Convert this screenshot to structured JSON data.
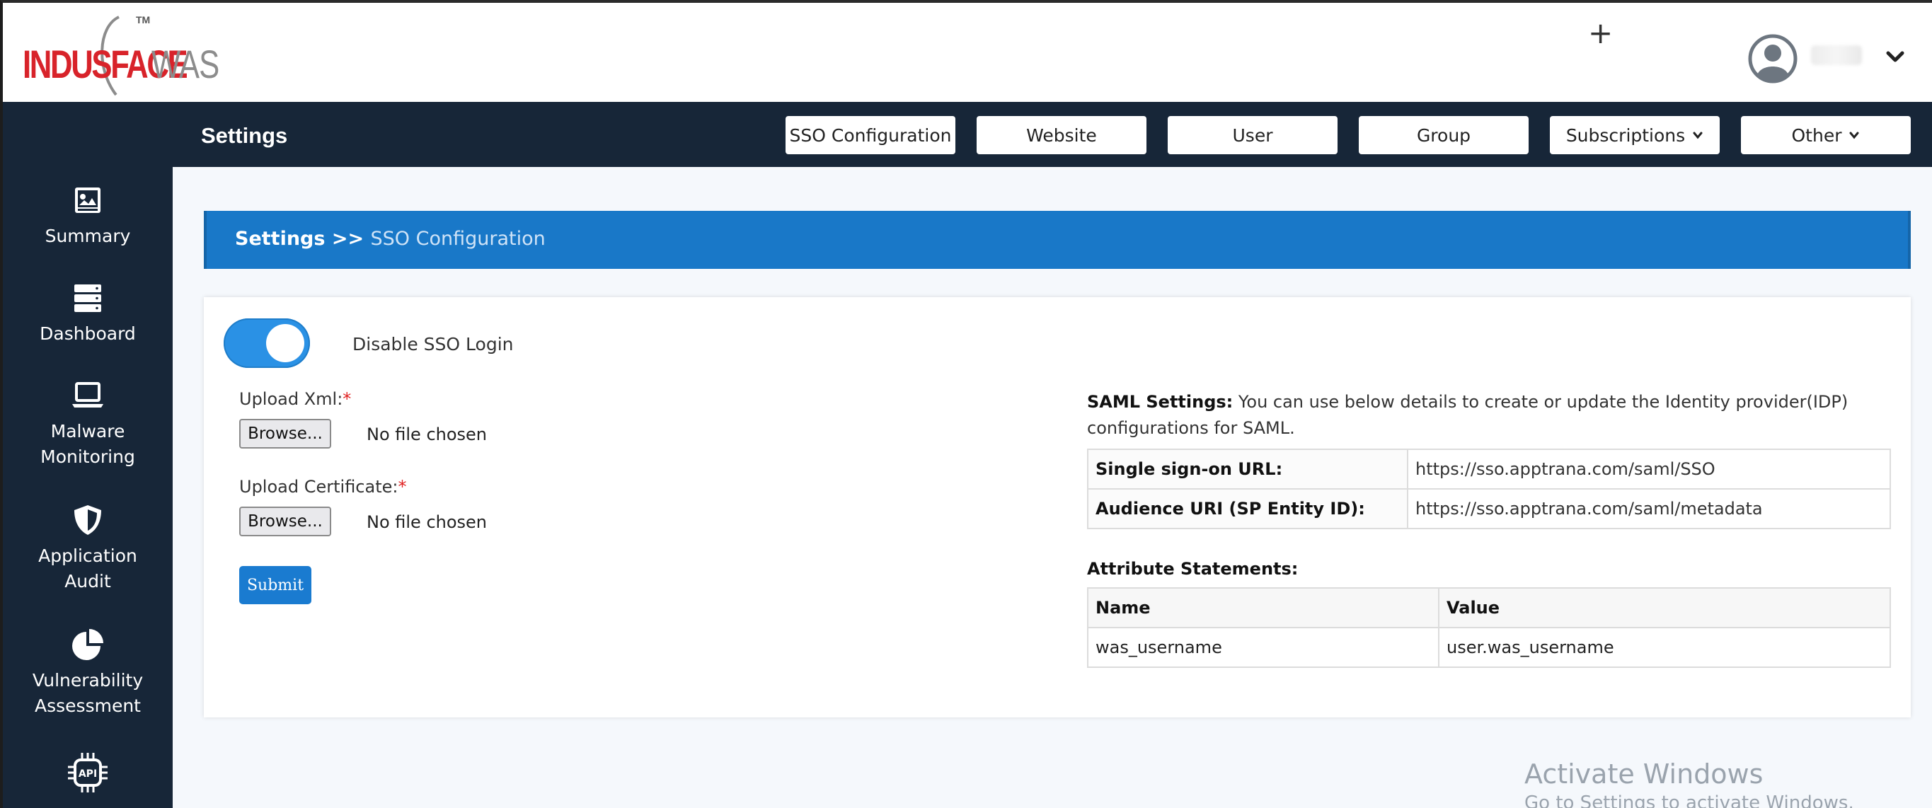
{
  "brand": {
    "logo_primary": "INDUSFACE",
    "logo_secondary": "WAS",
    "trademark": "TM"
  },
  "header": {
    "user_name": "",
    "colors": {
      "background": "#ffffff",
      "logo_red": "#d8232a",
      "logo_gray": "#8c8c8c"
    }
  },
  "settings_bar": {
    "title": "Settings",
    "nav": [
      {
        "label": "SSO Configuration",
        "dropdown": false
      },
      {
        "label": "Website",
        "dropdown": false
      },
      {
        "label": "User",
        "dropdown": false
      },
      {
        "label": "Group",
        "dropdown": false
      },
      {
        "label": "Subscriptions",
        "dropdown": true
      },
      {
        "label": "Other",
        "dropdown": true
      }
    ]
  },
  "sidebar": {
    "items": [
      {
        "label_line1": "Summary",
        "label_line2": "",
        "icon": "summary-icon"
      },
      {
        "label_line1": "Dashboard",
        "label_line2": "",
        "icon": "dashboard-icon"
      },
      {
        "label_line1": "Malware",
        "label_line2": "Monitoring",
        "icon": "laptop-icon"
      },
      {
        "label_line1": "Application",
        "label_line2": "Audit",
        "icon": "shield-icon"
      },
      {
        "label_line1": "Vulnerability",
        "label_line2": "Assessment",
        "icon": "pie-chart-icon"
      },
      {
        "label_line1": "",
        "label_line2": "",
        "icon": "api-chip-icon",
        "icon_text": "API"
      }
    ]
  },
  "breadcrumb": {
    "root": "Settings",
    "separator": ">>",
    "current": "SSO Configuration"
  },
  "sso": {
    "toggle_label": "Disable SSO Login",
    "toggle_on": true,
    "upload_xml_label": "Upload Xml:",
    "upload_cert_label": "Upload Certificate:",
    "required_mark": "*",
    "browse_label": "Browse...",
    "no_file_text": "No file chosen",
    "submit_label": "Submit"
  },
  "saml": {
    "heading_bold": "SAML Settings:",
    "heading_text": " You can use below details to create or update the Identity provider(IDP) configurations for SAML.",
    "rows": [
      {
        "key": "Single sign-on URL:",
        "value": "https://sso.apptrana.com/saml/SSO"
      },
      {
        "key": "Audience URI (SP Entity ID):",
        "value": "https://sso.apptrana.com/saml/metadata"
      }
    ]
  },
  "attributes": {
    "title": "Attribute Statements:",
    "headers": [
      "Name",
      "Value"
    ],
    "rows": [
      [
        "was_username",
        "user.was_username"
      ]
    ]
  },
  "watermark": {
    "line1": "Activate Windows",
    "line2": "Go to Settings to activate Windows."
  },
  "colors": {
    "nav_dark": "#172638",
    "accent_blue": "#1978c8",
    "toggle_blue": "#2a91e5",
    "required_red": "#e02020"
  }
}
